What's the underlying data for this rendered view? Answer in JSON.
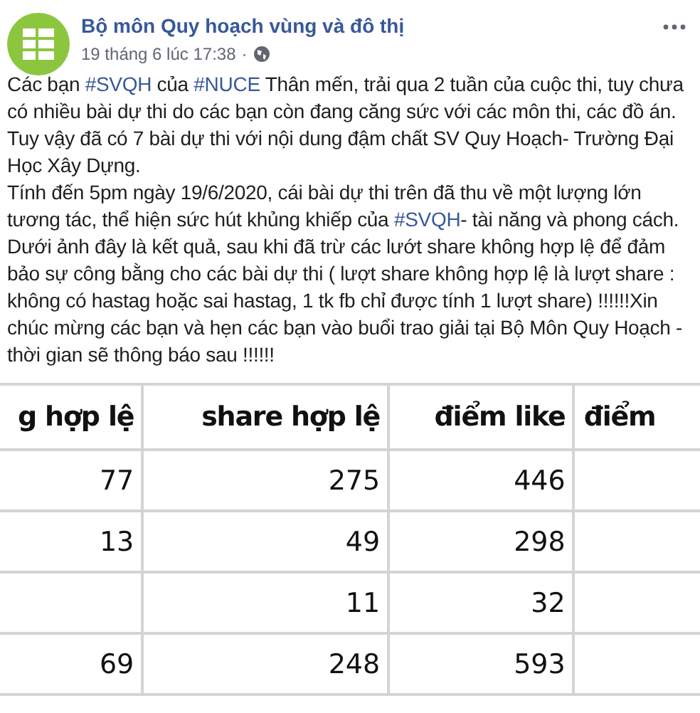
{
  "post": {
    "author": "Bộ môn Quy hoạch vùng và đô thị",
    "time": "19 tháng 6 lúc 17:38",
    "separator": "·",
    "paragraphs": [
      [
        {
          "kind": "text",
          "text": "Các bạn "
        },
        {
          "kind": "hashtag",
          "text": "#SVQH"
        },
        {
          "kind": "text",
          "text": " của "
        },
        {
          "kind": "hashtag",
          "text": "#NUCE"
        },
        {
          "kind": "text",
          "text": " Thân mến, trải qua 2 tuần của cuộc thi, tuy chưa có nhiều bài dự thi do các bạn còn đang căng sức với các môn thi, các đồ án. Tuy vậy đã có 7 bài dự thi với nội dung đậm chất SV Quy Hoạch- Trường Đại Học Xây Dựng."
        }
      ],
      [
        {
          "kind": "text",
          "text": "Tính đến 5pm ngày 19/6/2020, cái bài dự thi trên đã thu về một lượng lớn tương tác, thể hiện sức hút khủng khiếp của "
        },
        {
          "kind": "hashtag",
          "text": "#SVQH"
        },
        {
          "kind": "text",
          "text": "- tài năng và phong cách."
        }
      ],
      [
        {
          "kind": "text",
          "text": "Dưới ảnh đây là kết quả, sau khi đã trừ các lướt share không hợp lệ để đảm bảo sự công bằng cho các bài dự thi ( lượt share không hợp lệ là lượt share : không có hastag hoặc sai hastag, 1 tk fb chỉ được tính 1 lượt share) !!!!!!Xin chúc mừng các bạn và hẹn các bạn vào buổi trao giải tại Bộ Môn Quy Hoạch -thời gian sẽ thông báo sau !!!!!!"
        }
      ]
    ]
  },
  "table": {
    "columns": [
      "g hợp lệ",
      "share hợp lệ",
      "điểm like",
      "điểm"
    ],
    "rows": [
      [
        "77",
        "275",
        "446",
        ""
      ],
      [
        "13",
        "49",
        "298",
        ""
      ],
      [
        "",
        "11",
        "32",
        ""
      ],
      [
        "69",
        "248",
        "593",
        ""
      ]
    ]
  }
}
